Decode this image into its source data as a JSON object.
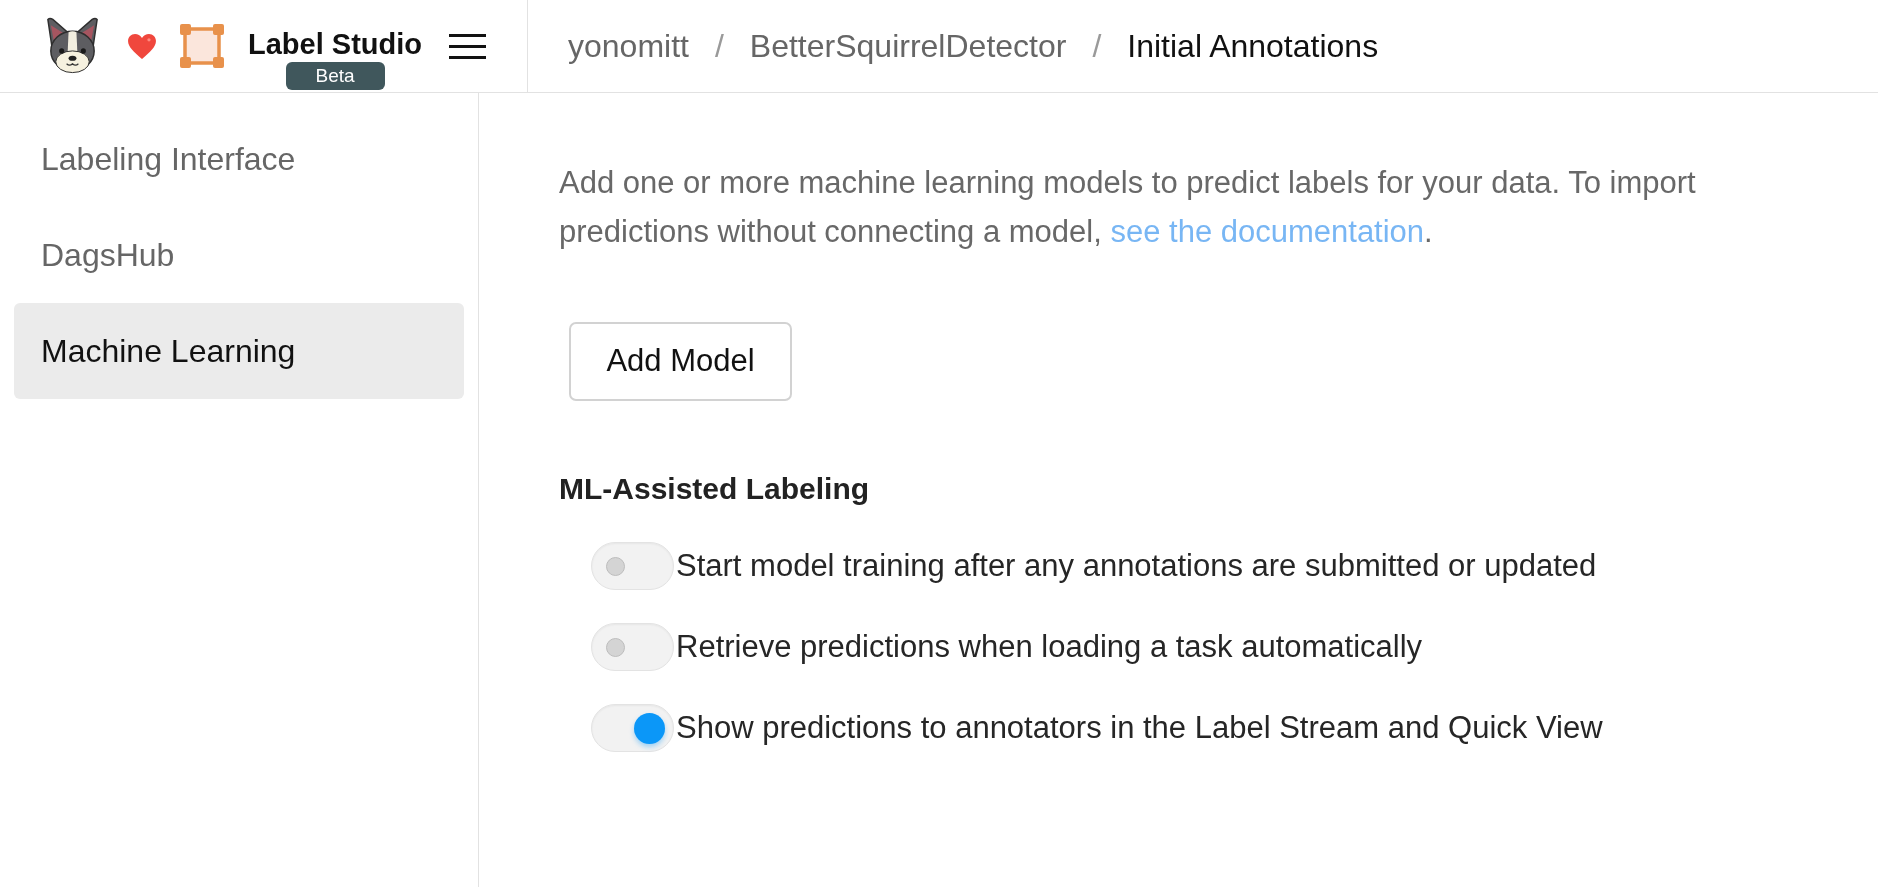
{
  "header": {
    "app_name": "Label Studio",
    "badge": "Beta",
    "breadcrumb": [
      {
        "label": "yonomitt",
        "current": false
      },
      {
        "separator": "/",
        "label": "BetterSquirrelDetector",
        "current": false
      },
      {
        "separator": "/",
        "label": "Initial Annotations",
        "current": true
      }
    ]
  },
  "sidebar": {
    "items": [
      {
        "label": "Labeling Interface",
        "selected": false
      },
      {
        "label": "DagsHub",
        "selected": false
      },
      {
        "label": "Machine Learning",
        "selected": true
      }
    ]
  },
  "main": {
    "description": {
      "text": "Add one or more machine learning models to predict labels for your data. To import predictions without connecting a model, ",
      "link": "see the documentation",
      "end": "."
    },
    "add_button": "Add Model",
    "ml_assisted": {
      "title": "ML-Assisted Labeling",
      "options": [
        {
          "label": "Start model training after any annotations are submitted or updated",
          "on": false
        },
        {
          "label": "Retrieve predictions when loading a task automatically",
          "on": false
        },
        {
          "label": "Show predictions to annotators in the Label Stream and Quick View",
          "on": true
        }
      ]
    }
  }
}
